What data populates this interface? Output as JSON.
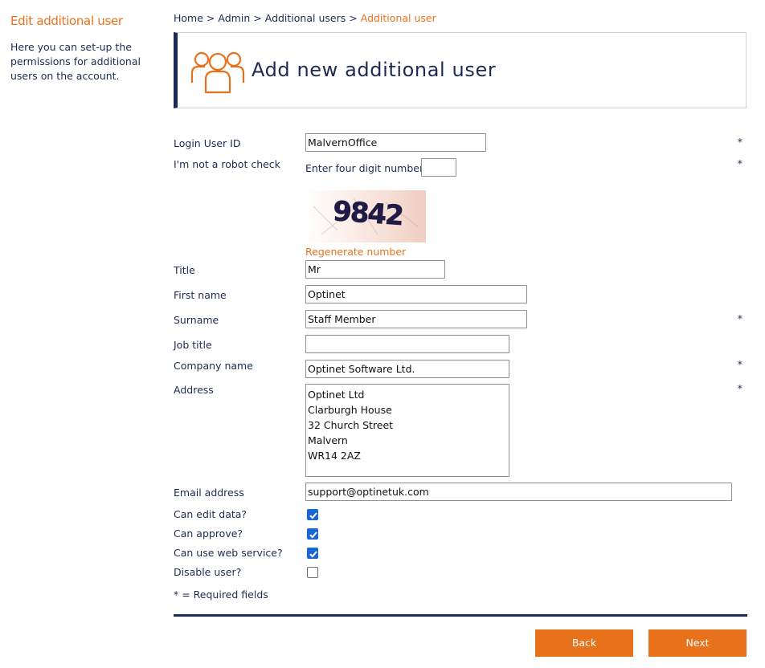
{
  "sidebar": {
    "title": "Edit additional user",
    "description": "Here you can set-up the permissions for additional users on the account."
  },
  "breadcrumb": {
    "items": [
      "Home",
      "Admin",
      "Additional users"
    ],
    "current": "Additional user",
    "separator": ">"
  },
  "header": {
    "title": "Add new additional user",
    "icon": "users-group-icon"
  },
  "form": {
    "login_user_id": {
      "label": "Login User ID",
      "value": "MalvernOffice",
      "required": "*"
    },
    "robot_check": {
      "label": "I'm not a robot check",
      "prompt": "Enter four digit number:",
      "value": "",
      "required": "*",
      "captcha_digits": "9842",
      "regenerate_label": "Regenerate number"
    },
    "title": {
      "label": "Title",
      "value": "Mr"
    },
    "first_name": {
      "label": "First name",
      "value": "Optinet"
    },
    "surname": {
      "label": "Surname",
      "value": "Staff Member",
      "required": "*"
    },
    "job_title": {
      "label": "Job title",
      "value": ""
    },
    "company_name": {
      "label": "Company name",
      "value": "Optinet Software Ltd.",
      "required": "*"
    },
    "address": {
      "label": "Address",
      "value": "Optinet Ltd\nClarburgh House\n32 Church Street\nMalvern\nWR14 2AZ",
      "required": "*"
    },
    "email": {
      "label": "Email address",
      "value": "support@optinetuk.com"
    },
    "can_edit": {
      "label": "Can edit data?",
      "checked": true
    },
    "can_approve": {
      "label": "Can approve?",
      "checked": true
    },
    "can_use_web_service": {
      "label": "Can use web service?",
      "checked": true
    },
    "disable_user": {
      "label": "Disable user?",
      "checked": false
    },
    "required_note": "* = Required fields"
  },
  "buttons": {
    "back": "Back",
    "next": "Next"
  },
  "colors": {
    "accent": "#e8711c",
    "navy": "#1c2b53",
    "checkbox": "#1a66d6"
  }
}
